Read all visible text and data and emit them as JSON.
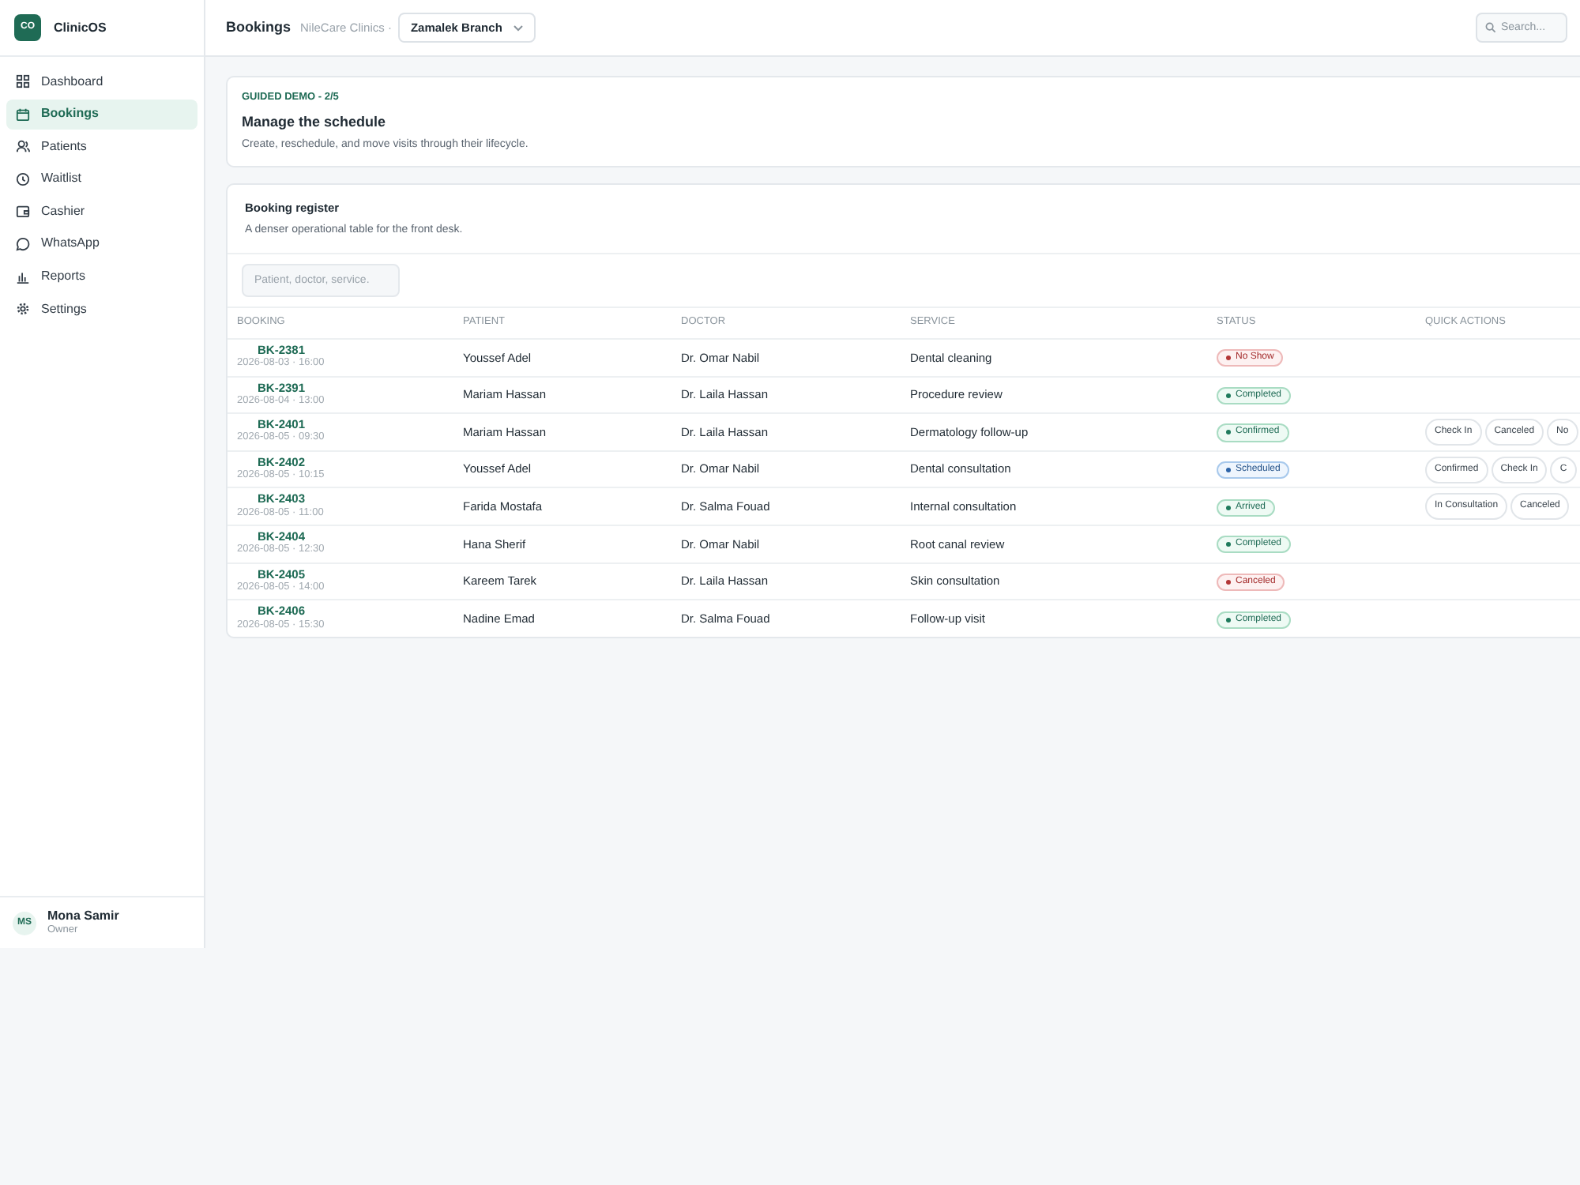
{
  "brand": {
    "logo": "CO",
    "name": "ClinicOS"
  },
  "sidebar": {
    "items": [
      {
        "label": "Dashboard",
        "selected": false
      },
      {
        "label": "Bookings",
        "selected": true
      },
      {
        "label": "Patients",
        "selected": false
      },
      {
        "label": "Waitlist",
        "selected": false
      },
      {
        "label": "Cashier",
        "selected": false
      },
      {
        "label": "WhatsApp",
        "selected": false
      },
      {
        "label": "Reports",
        "selected": false
      },
      {
        "label": "Settings",
        "selected": false
      }
    ]
  },
  "user": {
    "initials": "MS",
    "name": "Mona Samir",
    "role": "Owner"
  },
  "header": {
    "title": "Bookings",
    "org": "NileCare Clinics ·",
    "branch": "Zamalek Branch",
    "search_placeholder": "Search..."
  },
  "guide": {
    "step": "GUIDED DEMO - 2/5",
    "title": "Manage the schedule",
    "text": "Create, reschedule, and move visits through their lifecycle."
  },
  "register": {
    "title": "Booking register",
    "subtitle": "A denser operational table for the front desk.",
    "filter_placeholder": "Patient, doctor, service.",
    "columns": [
      "BOOKING",
      "PATIENT",
      "DOCTOR",
      "SERVICE",
      "STATUS",
      "QUICK ACTIONS"
    ],
    "rows": [
      {
        "id": "BK-2381",
        "when": "2026-08-03 · 16:00",
        "patient": "Youssef Adel",
        "doctor": "Dr. Omar Nabil",
        "service": "Dental cleaning",
        "status": "No Show",
        "kind": "danger",
        "actions": []
      },
      {
        "id": "BK-2391",
        "when": "2026-08-04 · 13:00",
        "patient": "Mariam Hassan",
        "doctor": "Dr. Laila Hassan",
        "service": "Procedure review",
        "status": "Completed",
        "kind": "success",
        "actions": []
      },
      {
        "id": "BK-2401",
        "when": "2026-08-05 · 09:30",
        "patient": "Mariam Hassan",
        "doctor": "Dr. Laila Hassan",
        "service": "Dermatology follow-up",
        "status": "Confirmed",
        "kind": "success",
        "actions": [
          "Check In",
          "Canceled",
          "No"
        ]
      },
      {
        "id": "BK-2402",
        "when": "2026-08-05 · 10:15",
        "patient": "Youssef Adel",
        "doctor": "Dr. Omar Nabil",
        "service": "Dental consultation",
        "status": "Scheduled",
        "kind": "info",
        "actions": [
          "Confirmed",
          "Check In",
          "C"
        ]
      },
      {
        "id": "BK-2403",
        "when": "2026-08-05 · 11:00",
        "patient": "Farida Mostafa",
        "doctor": "Dr. Salma Fouad",
        "service": "Internal consultation",
        "status": "Arrived",
        "kind": "success",
        "actions": [
          "In Consultation",
          "Canceled"
        ]
      },
      {
        "id": "BK-2404",
        "when": "2026-08-05 · 12:30",
        "patient": "Hana Sherif",
        "doctor": "Dr. Omar Nabil",
        "service": "Root canal review",
        "status": "Completed",
        "kind": "success",
        "actions": []
      },
      {
        "id": "BK-2405",
        "when": "2026-08-05 · 14:00",
        "patient": "Kareem Tarek",
        "doctor": "Dr. Laila Hassan",
        "service": "Skin consultation",
        "status": "Canceled",
        "kind": "danger",
        "actions": []
      },
      {
        "id": "BK-2406",
        "when": "2026-08-05 · 15:30",
        "patient": "Nadine Emad",
        "doctor": "Dr. Salma Fouad",
        "service": "Follow-up visit",
        "status": "Completed",
        "kind": "success",
        "actions": []
      }
    ]
  }
}
